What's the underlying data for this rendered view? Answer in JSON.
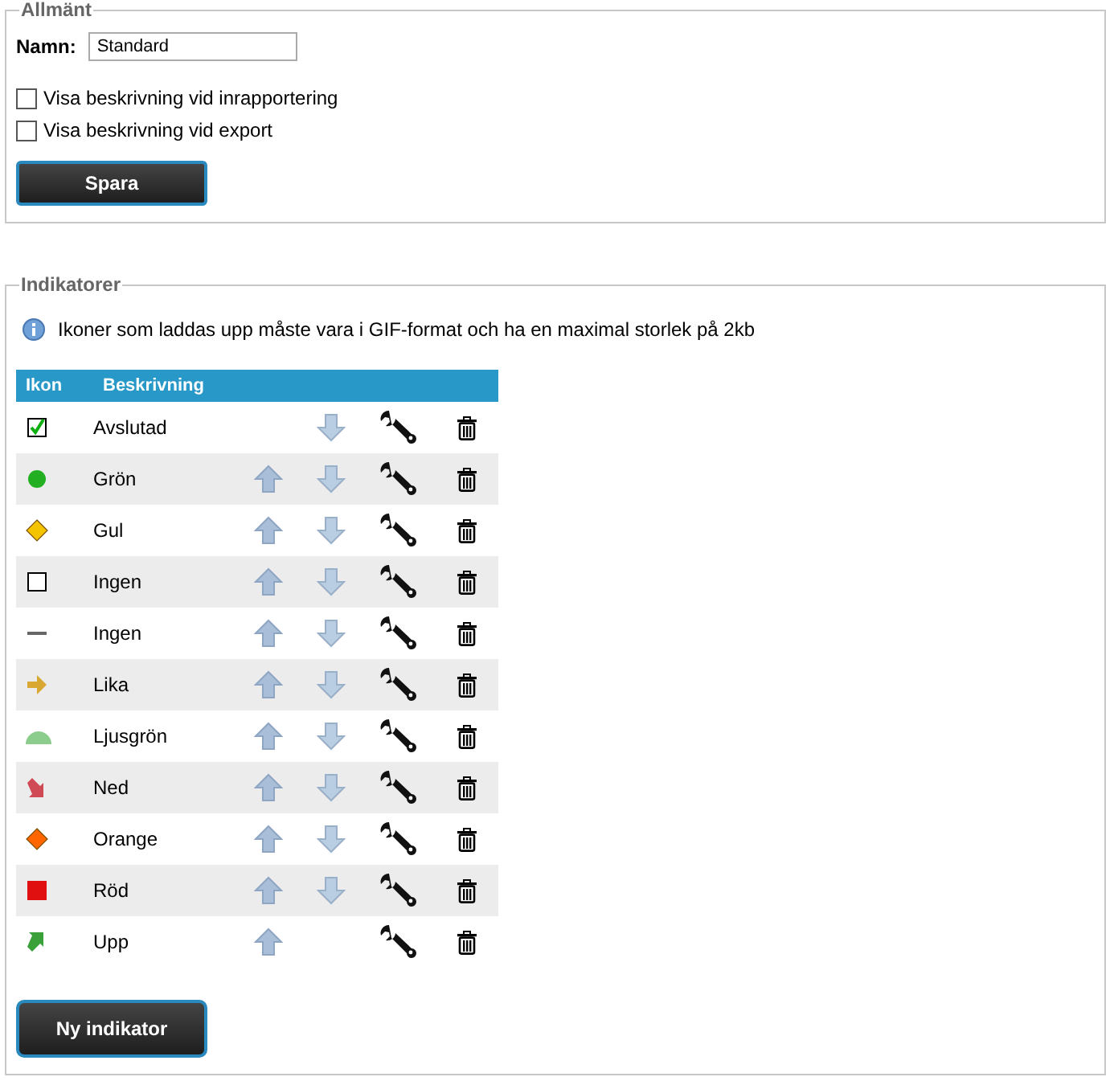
{
  "general": {
    "legend": "Allmänt",
    "name_label": "Namn:",
    "name_value": "Standard",
    "options": [
      {
        "label": "Visa beskrivning vid inrapportering",
        "checked": false
      },
      {
        "label": "Visa beskrivning vid export",
        "checked": false
      }
    ],
    "save_button": "Spara"
  },
  "indicators": {
    "legend": "Indikatorer",
    "info": "Ikoner som laddas upp måste vara i GIF-format och ha en maximal storlek på 2kb",
    "columns": [
      "Ikon",
      "Beskrivning"
    ],
    "rows": [
      {
        "kind": "check",
        "color": "#10b010",
        "label": "Avslutad",
        "move_up": false,
        "move_down": true
      },
      {
        "kind": "circle",
        "color": "#22b022",
        "label": "Grön",
        "move_up": true,
        "move_down": true
      },
      {
        "kind": "diamond",
        "color": "#f5c400",
        "label": "Gul",
        "move_up": true,
        "move_down": true
      },
      {
        "kind": "box",
        "color": "#000000",
        "label": "Ingen",
        "move_up": true,
        "move_down": true
      },
      {
        "kind": "dash",
        "color": "#666666",
        "label": "Ingen",
        "move_up": true,
        "move_down": true
      },
      {
        "kind": "arrow-right",
        "color": "#d9a832",
        "label": "Lika",
        "move_up": true,
        "move_down": true
      },
      {
        "kind": "dome",
        "color": "#8ccc8c",
        "label": "Ljusgrön",
        "move_up": true,
        "move_down": true
      },
      {
        "kind": "arrow-down-right",
        "color": "#d04a55",
        "label": "Ned",
        "move_up": true,
        "move_down": true
      },
      {
        "kind": "diamond",
        "color": "#ff6600",
        "label": "Orange",
        "move_up": true,
        "move_down": true
      },
      {
        "kind": "square",
        "color": "#e01010",
        "label": "Röd",
        "move_up": true,
        "move_down": true
      },
      {
        "kind": "arrow-up-right",
        "color": "#3aa03a",
        "label": "Upp",
        "move_up": true,
        "move_down": false
      }
    ],
    "new_button": "Ny indikator"
  }
}
